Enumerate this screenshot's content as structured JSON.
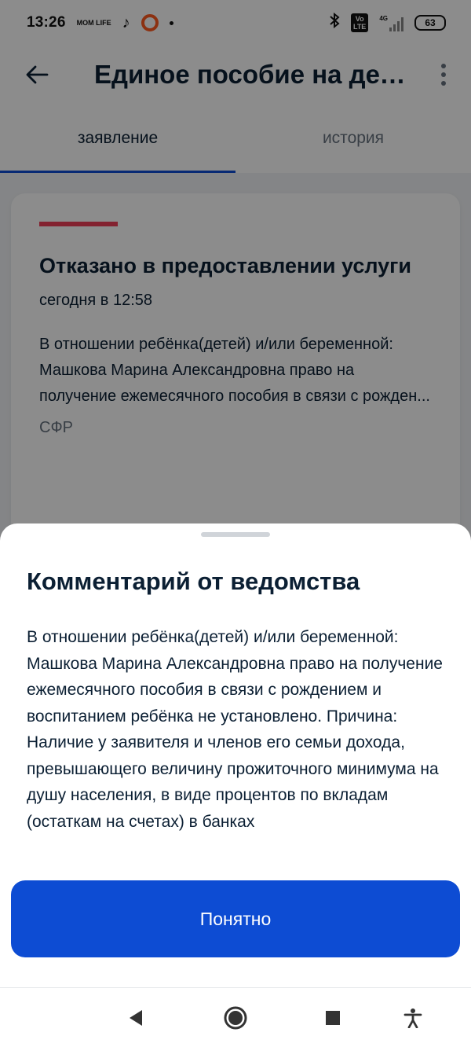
{
  "status_bar": {
    "time": "13:26",
    "app_badge": "MOM LIFE",
    "network": "4G",
    "battery": "63",
    "icons": [
      "momlife-icon",
      "tiktok-icon",
      "ring-notification-icon",
      "dot-icon",
      "bluetooth-icon",
      "volte-icon",
      "signal-icon",
      "battery-icon"
    ]
  },
  "app_bar": {
    "title": "Единое пособие на дет…"
  },
  "tabs": [
    {
      "label": "заявление",
      "active": true
    },
    {
      "label": "история",
      "active": false
    }
  ],
  "card": {
    "title": "Отказано в предоставлении услуги",
    "time": "сегодня в 12:58",
    "text": "В отношении ребёнка(детей) и/или беременной: Машкова Марина Александровна право на получение ежемесячного пособия в связи с рожден...",
    "source": "СФР",
    "stripe_color": "#ee3f58"
  },
  "sheet": {
    "title": "Комментарий от ведомства",
    "body": "В отношении ребёнка(детей) и/или беременной: Машкова Марина Александровна право на получение ежемесячного пособия в связи с рождением и воспитанием ребёнка не установлено. Причина: Наличие у заявителя и членов его семьи дохода, превышающего величину прожиточного минимума на душу населения, в виде процентов по вкладам (остаткам на счетах) в банках",
    "button_label": "Понятно"
  },
  "colors": {
    "accent": "#0d4cd3",
    "text": "#0b1f33",
    "secondary_text": "#66727f"
  },
  "nav_bar": {
    "icons": [
      "back-triangle-icon",
      "home-circle-icon",
      "recents-square-icon",
      "accessibility-icon"
    ]
  }
}
